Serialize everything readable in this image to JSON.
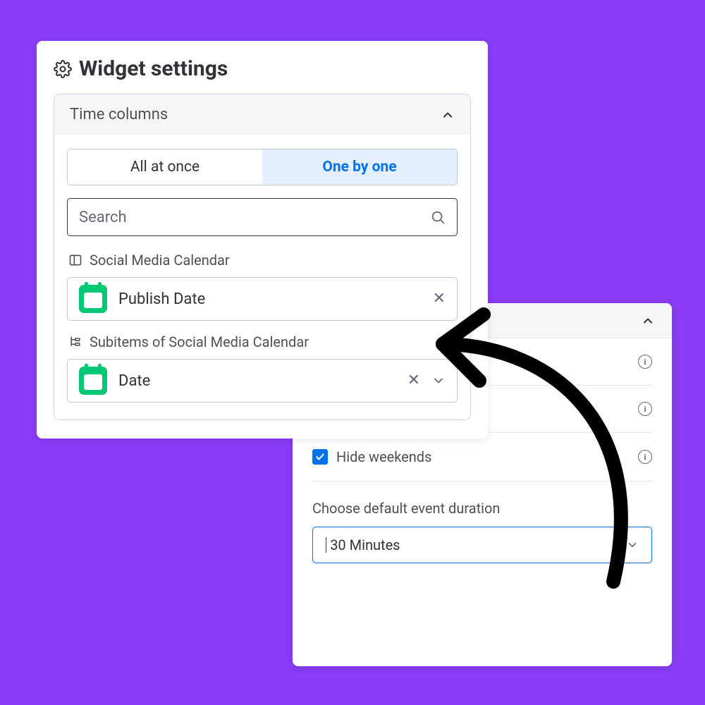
{
  "front": {
    "title": "Widget settings",
    "section_label": "Time columns",
    "toggle": {
      "all": "All at once",
      "one": "One by one"
    },
    "search_placeholder": "Search",
    "group1_label": "Social Media Calendar",
    "group1_column": "Publish Date",
    "group2_label": "Subitems of Social Media Calendar",
    "group2_column": "Date"
  },
  "back": {
    "hide_weekends": "Hide weekends",
    "duration_label": "Choose default event duration",
    "duration_value": "30 Minutes"
  }
}
